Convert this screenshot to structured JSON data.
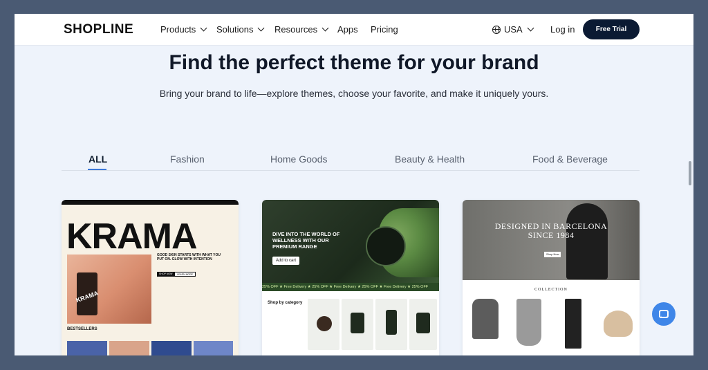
{
  "nav": {
    "logo": "SHOPLINE",
    "items": [
      {
        "label": "Products",
        "has_dropdown": true
      },
      {
        "label": "Solutions",
        "has_dropdown": true
      },
      {
        "label": "Resources",
        "has_dropdown": true
      },
      {
        "label": "Apps",
        "has_dropdown": false
      },
      {
        "label": "Pricing",
        "has_dropdown": false
      }
    ],
    "region": {
      "label": "USA",
      "icon": "globe-icon"
    },
    "login": "Log in",
    "cta": "Free Trial"
  },
  "hero": {
    "title": "Find the perfect theme for your brand",
    "subtitle": "Bring your brand to life—explore themes, choose your favorite, and make it uniquely yours."
  },
  "tabs": [
    {
      "label": "ALL",
      "active": true
    },
    {
      "label": "Fashion",
      "active": false
    },
    {
      "label": "Home Goods",
      "active": false
    },
    {
      "label": "Beauty & Health",
      "active": false
    },
    {
      "label": "Food & Beverage",
      "active": false
    }
  ],
  "themes": [
    {
      "brand": "KRAMA",
      "tagline": "GOOD SKIN STARTS WITH WHAT YOU PUT ON. GLOW WITH INTENTION",
      "buttons": [
        "SHOP NOW",
        "LEARN MORE"
      ],
      "section": "BESTSELLERS",
      "bottle_label": "KRAMA"
    },
    {
      "headline": "DIVE INTO THE WORLD OF WELLNESS WITH OUR PREMIUM RANGE",
      "button": "Add to cart",
      "ticker": "25% OFF  ★ Free Delivery  ★ 25% OFF  ★ Free Delivery  ★ 25% OFF  ★ Free Delivery  ★ 25% OFF",
      "section": "Shop by category"
    },
    {
      "headline_line1": "DESIGNED IN BARCELONA",
      "headline_line2": "SINCE 1984",
      "button": "Shop Now",
      "section": "COLLECTION"
    }
  ],
  "colors": {
    "nav_cta_bg": "#0b1a33",
    "tab_active_underline": "#3c78d8",
    "chat_button": "#3f86e8",
    "page_bg": "#eef3fb"
  },
  "chat": {
    "icon": "chat-bubble-icon"
  }
}
